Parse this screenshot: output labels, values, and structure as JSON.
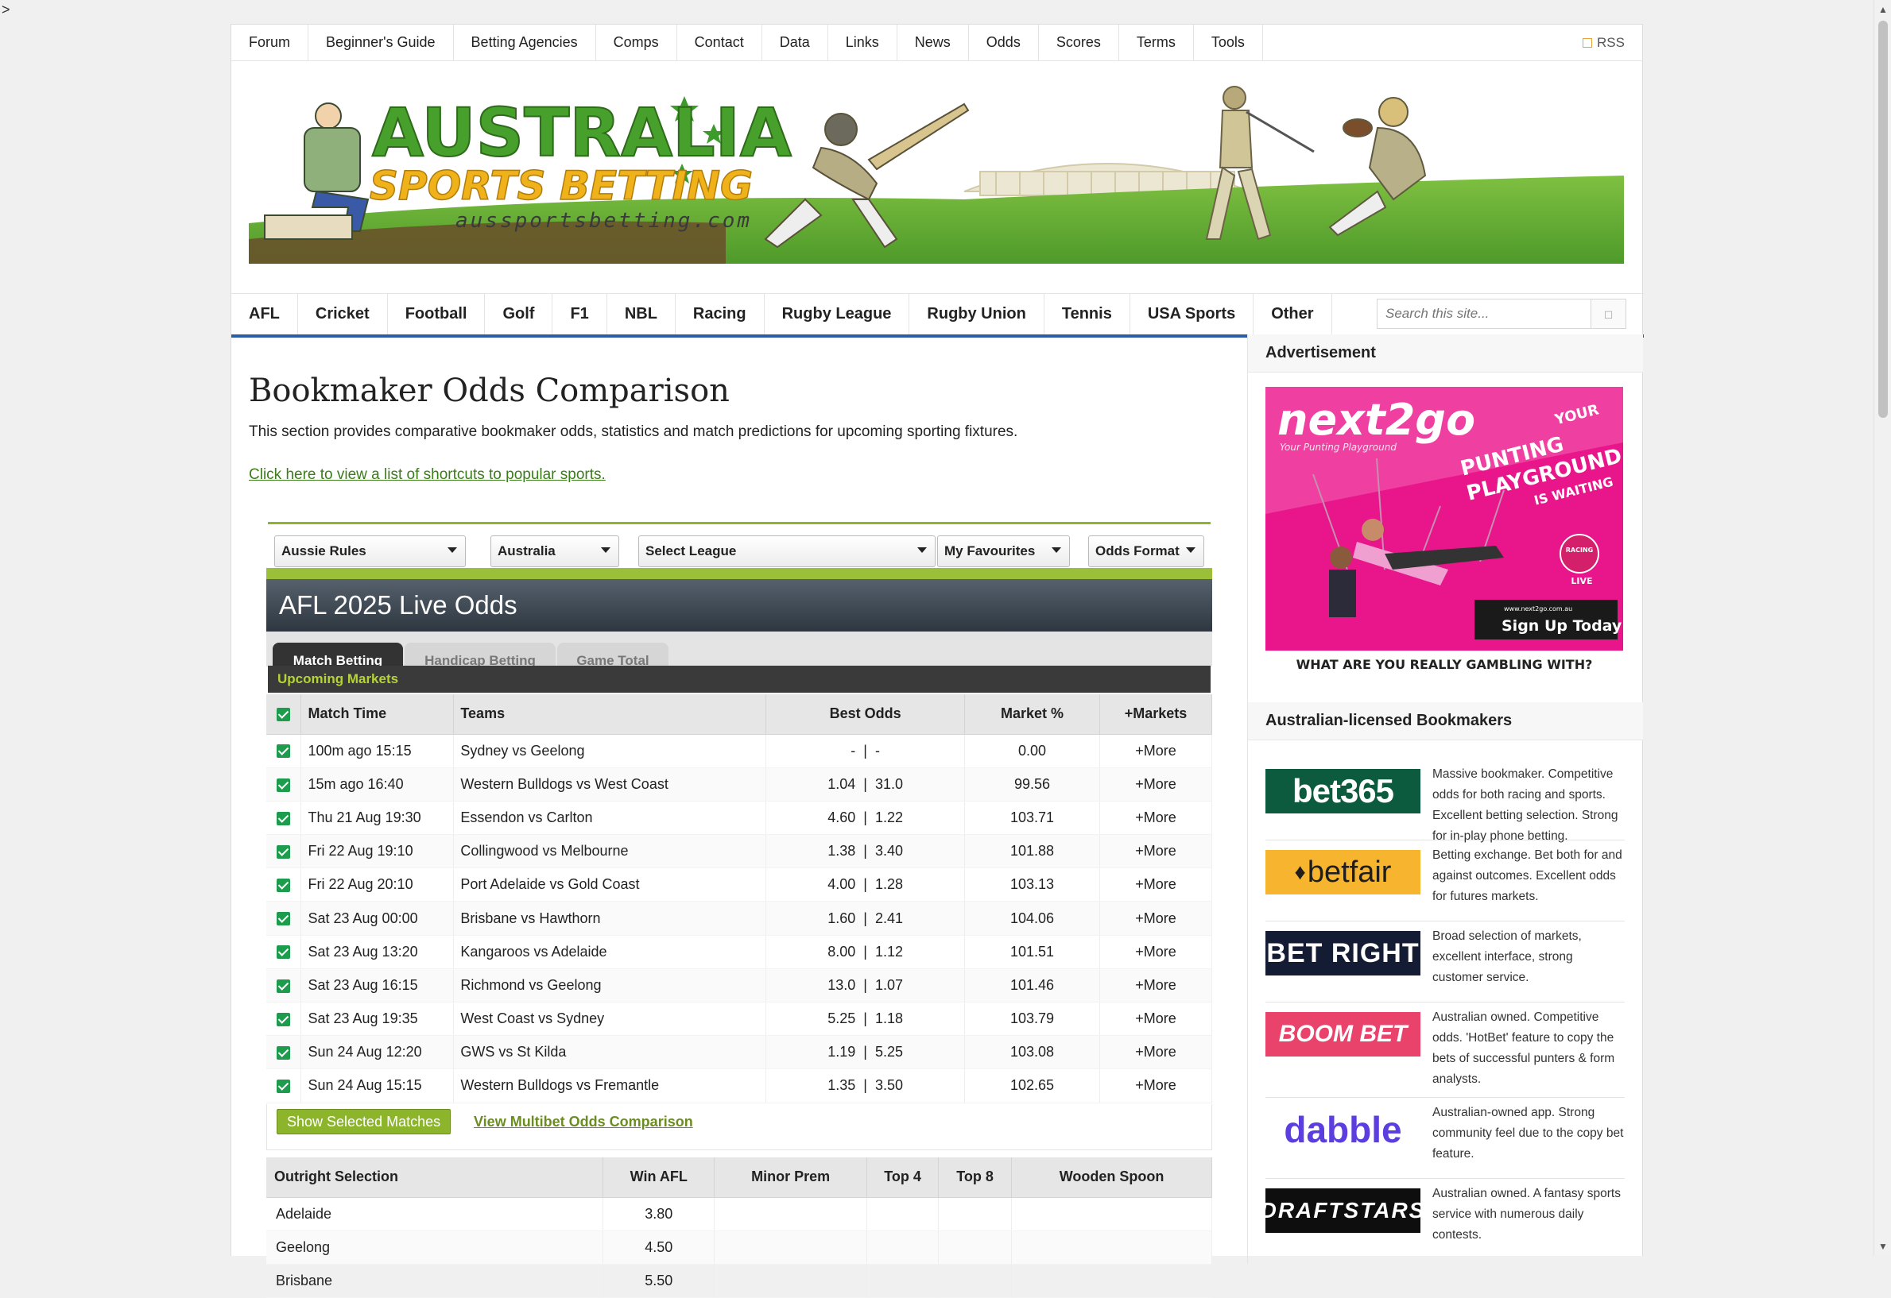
{
  "gt": ">",
  "topnav": {
    "items": [
      "Forum",
      "Beginner's Guide",
      "Betting Agencies",
      "Comps",
      "Contact",
      "Data",
      "Links",
      "News",
      "Odds",
      "Scores",
      "Terms",
      "Tools"
    ],
    "rss": "RSS"
  },
  "banner": {
    "title_line1": "AUSTRALIA",
    "title_line2": "SPORTS BETTING",
    "domain": "aussportsbetting.com"
  },
  "sportnav": {
    "items": [
      "AFL",
      "Cricket",
      "Football",
      "Golf",
      "F1",
      "NBL",
      "Racing",
      "Rugby League",
      "Rugby Union",
      "Tennis",
      "USA Sports",
      "Other"
    ],
    "search_placeholder": "Search this site..."
  },
  "main": {
    "title": "Bookmaker Odds Comparison",
    "intro": "This section provides comparative bookmaker odds, statistics and match predictions for upcoming sporting fixtures.",
    "shortcut_link": "Click here to view a list of shortcuts to popular sports."
  },
  "widget": {
    "dropdowns": [
      "Aussie Rules",
      "Australia",
      "Select League",
      "My Favourites",
      "Odds Format"
    ],
    "live_title": "AFL 2025 Live Odds",
    "tabs": [
      "Match Betting",
      "Handicap Betting",
      "Game Total"
    ],
    "upcoming": "Upcoming Markets",
    "columns": [
      "Match Time",
      "Teams",
      "Best Odds",
      "Market %",
      "+Markets"
    ],
    "matches": [
      {
        "time": "100m ago 15:15",
        "teams": "Sydney vs Geelong",
        "odds1": "-",
        "odds2": "-",
        "market": "0.00",
        "more": "+More"
      },
      {
        "time": "15m ago 16:40",
        "teams": "Western Bulldogs vs West Coast",
        "odds1": "1.04",
        "odds2": "31.0",
        "market": "99.56",
        "more": "+More"
      },
      {
        "time": "Thu 21 Aug 19:30",
        "teams": "Essendon vs Carlton",
        "odds1": "4.60",
        "odds2": "1.22",
        "market": "103.71",
        "more": "+More"
      },
      {
        "time": "Fri 22 Aug 19:10",
        "teams": "Collingwood vs Melbourne",
        "odds1": "1.38",
        "odds2": "3.40",
        "market": "101.88",
        "more": "+More"
      },
      {
        "time": "Fri 22 Aug 20:10",
        "teams": "Port Adelaide vs Gold Coast",
        "odds1": "4.00",
        "odds2": "1.28",
        "market": "103.13",
        "more": "+More"
      },
      {
        "time": "Sat 23 Aug 00:00",
        "teams": "Brisbane vs Hawthorn",
        "odds1": "1.60",
        "odds2": "2.41",
        "market": "104.06",
        "more": "+More"
      },
      {
        "time": "Sat 23 Aug 13:20",
        "teams": "Kangaroos vs Adelaide",
        "odds1": "8.00",
        "odds2": "1.12",
        "market": "101.51",
        "more": "+More"
      },
      {
        "time": "Sat 23 Aug 16:15",
        "teams": "Richmond vs Geelong",
        "odds1": "13.0",
        "odds2": "1.07",
        "market": "101.46",
        "more": "+More"
      },
      {
        "time": "Sat 23 Aug 19:35",
        "teams": "West Coast vs Sydney",
        "odds1": "5.25",
        "odds2": "1.18",
        "market": "103.79",
        "more": "+More"
      },
      {
        "time": "Sun 24 Aug 12:20",
        "teams": "GWS vs St Kilda",
        "odds1": "1.19",
        "odds2": "5.25",
        "market": "103.08",
        "more": "+More"
      },
      {
        "time": "Sun 24 Aug 15:15",
        "teams": "Western Bulldogs vs Fremantle",
        "odds1": "1.35",
        "odds2": "3.50",
        "market": "102.65",
        "more": "+More"
      }
    ],
    "show_button": "Show Selected Matches",
    "multibet_link": "View Multibet Odds Comparison",
    "outright_columns": [
      "Outright Selection",
      "Win AFL",
      "Minor Prem",
      "Top 4",
      "Top 8",
      "Wooden Spoon"
    ],
    "outright": [
      {
        "team": "Adelaide",
        "win": "3.80"
      },
      {
        "team": "Geelong",
        "win": "4.50"
      },
      {
        "team": "Brisbane",
        "win": "5.50"
      }
    ]
  },
  "sidebar": {
    "ad_heading": "Advertisement",
    "ad": {
      "brand": "next2go",
      "tagline": "Your Punting Playground",
      "line1": "YOUR",
      "line2": "PUNTING",
      "line3": "PLAYGROUND",
      "line4": "IS WAITING",
      "badge": "RACING",
      "badge_live": "LIVE",
      "url": "www.next2go.com.au",
      "cta": "Sign Up Today",
      "footer": "WHAT ARE YOU REALLY GAMBLING WITH?"
    },
    "bookies_heading": "Australian-licensed Bookmakers",
    "bookies": [
      {
        "name": "bet365",
        "desc": "Massive bookmaker. Competitive odds for both racing and sports. Excellent betting selection. Strong for in-play phone betting."
      },
      {
        "name": "betfair",
        "desc": "Betting exchange. Bet both for and against outcomes. Excellent odds for futures markets."
      },
      {
        "name": "BET RIGHT",
        "desc": "Broad selection of markets, excellent interface, strong customer service."
      },
      {
        "name": "BOOM BET",
        "desc": "Australian owned. Competitive odds. 'HotBet' feature to copy the bets of successful punters & form analysts."
      },
      {
        "name": "dabble",
        "desc": "Australian-owned app. Strong community feel due to the copy bet feature."
      },
      {
        "name": "DRAFTSTARS",
        "desc": "Australian owned. A fantasy sports service with numerous daily contests."
      }
    ]
  },
  "colors": {
    "accent_green": "#8cb52c",
    "nav_blue": "#2b5ca8",
    "header_dark": "#2e3740",
    "check_green": "#1e9c4d"
  }
}
